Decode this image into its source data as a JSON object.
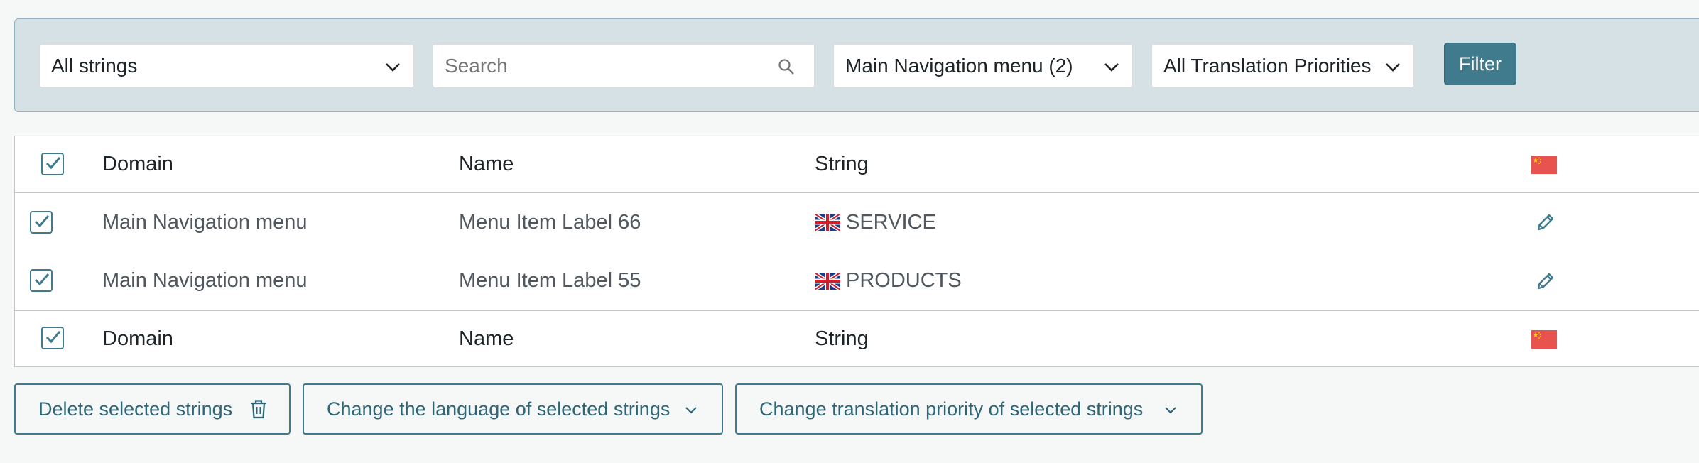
{
  "filters": {
    "strings_select": "All strings",
    "search_placeholder": "Search",
    "domain_select": "Main Navigation menu (2)",
    "priority_select": "All Translation Priorities",
    "filter_button": "Filter"
  },
  "table": {
    "headers": {
      "domain": "Domain",
      "name": "Name",
      "string": "String"
    },
    "rows": [
      {
        "domain": "Main Navigation menu",
        "name": "Menu Item Label 66",
        "string": "SERVICE",
        "checked": true
      },
      {
        "domain": "Main Navigation menu",
        "name": "Menu Item Label 55",
        "string": "PRODUCTS",
        "checked": true
      }
    ],
    "language_flag_icon": "flag-china-icon",
    "string_flag_icon": "flag-uk-icon"
  },
  "actions": {
    "delete": "Delete selected strings",
    "change_language": "Change the language of selected strings",
    "change_priority": "Change translation priority of selected strings"
  },
  "colors": {
    "accent": "#3f7b8d",
    "filter_bar_bg": "#d6e1e6"
  }
}
